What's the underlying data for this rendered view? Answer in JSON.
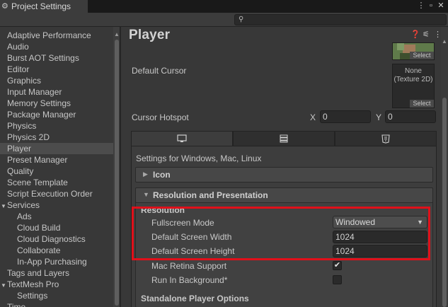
{
  "window": {
    "title": "Project Settings",
    "icons": {
      "tab": "gear-icon",
      "menu": "kebab-menu-icon",
      "maximize": "maximize-icon",
      "close": "close-icon"
    }
  },
  "search": {
    "placeholder": "",
    "icon": "search-icon"
  },
  "sidebar": {
    "items": [
      {
        "label": "Adaptive Performance"
      },
      {
        "label": "Audio"
      },
      {
        "label": "Burst AOT Settings"
      },
      {
        "label": "Editor"
      },
      {
        "label": "Graphics"
      },
      {
        "label": "Input Manager"
      },
      {
        "label": "Memory Settings"
      },
      {
        "label": "Package Manager"
      },
      {
        "label": "Physics"
      },
      {
        "label": "Physics 2D"
      },
      {
        "label": "Player",
        "selected": true
      },
      {
        "label": "Preset Manager"
      },
      {
        "label": "Quality"
      },
      {
        "label": "Scene Template"
      },
      {
        "label": "Script Execution Order"
      },
      {
        "label": "Services",
        "expanded": true
      },
      {
        "label": "Ads"
      },
      {
        "label": "Cloud Build"
      },
      {
        "label": "Cloud Diagnostics"
      },
      {
        "label": "Collaborate"
      },
      {
        "label": "In-App Purchasing"
      },
      {
        "label": "Tags and Layers"
      },
      {
        "label": "TextMesh Pro",
        "expanded": true
      },
      {
        "label": "Settings"
      },
      {
        "label": "Time"
      }
    ]
  },
  "main": {
    "title": "Player",
    "header_icons": [
      "help-icon",
      "preset-sliders-icon",
      "kebab-menu-icon"
    ],
    "icon_thumb_select": "Select",
    "default_cursor": {
      "label": "Default Cursor",
      "texture_text": "None\n(Texture 2D)",
      "select": "Select"
    },
    "cursor_hotspot": {
      "label": "Cursor Hotspot",
      "x_label": "X",
      "x_value": "0",
      "y_label": "Y",
      "y_value": "0"
    },
    "platform_tabs": [
      {
        "icon": "monitor-icon",
        "active": true
      },
      {
        "icon": "server-icon"
      },
      {
        "icon": "html5-icon"
      }
    ],
    "settings_for": "Settings for Windows, Mac, Linux",
    "sections": {
      "icon": "Icon",
      "resolution_presentation": "Resolution and Presentation"
    },
    "resolution": {
      "heading": "Resolution",
      "fullscreen_mode_label": "Fullscreen Mode",
      "fullscreen_mode_value": "Windowed",
      "default_width_label": "Default Screen Width",
      "default_width_value": "1024",
      "default_height_label": "Default Screen Height",
      "default_height_value": "1024",
      "mac_retina_label": "Mac Retina Support",
      "mac_retina_checked": true,
      "run_bg_label": "Run In Background*",
      "run_bg_checked": false
    },
    "standalone_heading": "Standalone Player Options"
  },
  "colors": {
    "highlight_border": "#e0101a",
    "panel_bg": "#383838",
    "sidebar_selected": "#4c4c4c"
  }
}
